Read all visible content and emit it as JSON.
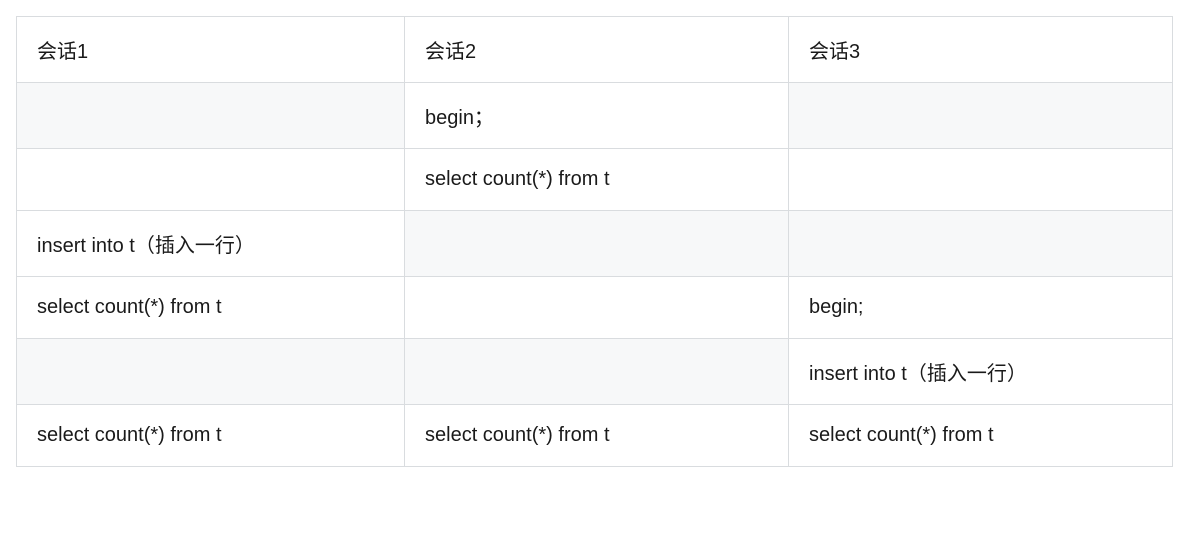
{
  "table": {
    "headers": [
      "会话1",
      "会话2",
      "会话3"
    ],
    "rows": [
      {
        "cells": [
          "",
          "begin；",
          ""
        ],
        "shaded": [
          true,
          false,
          true
        ]
      },
      {
        "cells": [
          "",
          "select count(*) from t",
          ""
        ],
        "shaded": [
          false,
          false,
          false
        ]
      },
      {
        "cells": [
          "insert into t（插入一行）",
          "",
          ""
        ],
        "shaded": [
          false,
          true,
          true
        ]
      },
      {
        "cells": [
          "select count(*) from t",
          "",
          "begin;"
        ],
        "shaded": [
          false,
          false,
          false
        ]
      },
      {
        "cells": [
          "",
          "",
          "insert into t（插入一行）"
        ],
        "shaded": [
          true,
          true,
          false
        ]
      },
      {
        "cells": [
          "select count(*) from t",
          "select count(*) from t",
          "select count(*) from t"
        ],
        "shaded": [
          false,
          false,
          false
        ]
      }
    ]
  }
}
